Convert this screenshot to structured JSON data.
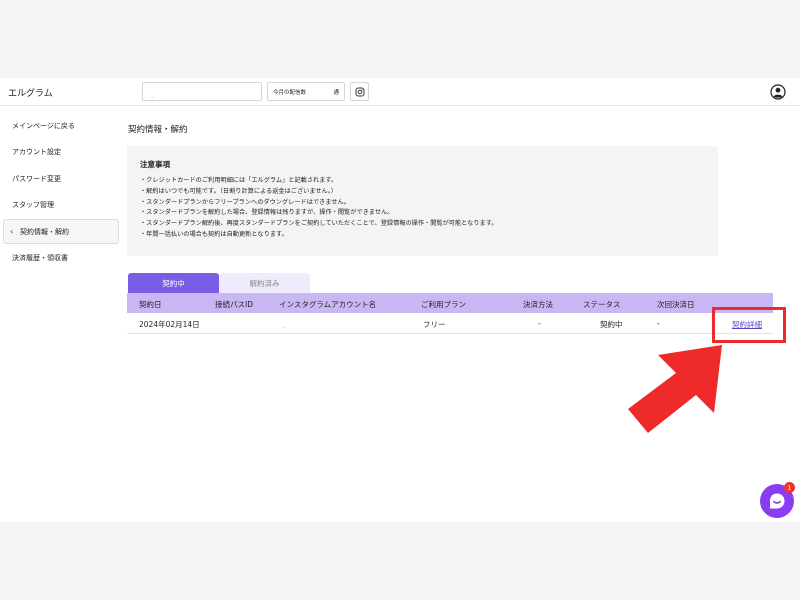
{
  "header": {
    "brand": "エルグラム",
    "search_placeholder": "_",
    "counter_label": "今月の配信数",
    "counter_unit": "通"
  },
  "sidebar": {
    "items": [
      {
        "label": "メインページに戻る"
      },
      {
        "label": "アカウント設定"
      },
      {
        "label": "パスワード変更"
      },
      {
        "label": "スタッフ管理"
      },
      {
        "label": "契約情報・解約",
        "active": true
      },
      {
        "label": "決済履歴・領収書"
      }
    ]
  },
  "main": {
    "title": "契約情報・解約",
    "notice": {
      "title": "注意事項",
      "lines": [
        "・クレジットカードのご利用明細には「エルグラム」と記載されます。",
        "・解約はいつでも可能です。（日割り計算による返金はございません。）",
        "・スタンダードプランからフリープランへのダウングレードはできません。",
        "・スタンダードプランを解約した場合、登録情報は残りますが、操作・閲覧ができません。",
        "・スタンダードプラン解約後、再度スタンダードプランをご契約していただくことで、登録情報の操作・閲覧が可能となります。",
        "・年間一括払いの場合も契約は自動更新となります。"
      ]
    },
    "tabs": [
      {
        "label": "契約中",
        "active": true
      },
      {
        "label": "解約済み",
        "active": false
      }
    ],
    "table": {
      "headers": [
        "契約日",
        "接続パスID",
        "インスタグラムアカウント名",
        "ご利用プラン",
        "決済方法",
        "ステータス",
        "次回決済日"
      ],
      "rows": [
        {
          "date": "2024年02月14日",
          "pass_id": "",
          "account": "_",
          "plan": "フリー",
          "payment": "-",
          "status": "契約中",
          "next_payment": "-",
          "link": "契約詳細"
        }
      ]
    }
  },
  "chat": {
    "badge": "1"
  },
  "colors": {
    "accent": "#7b5ce6",
    "table_header": "#c8b7f3",
    "annotation": "#ee2a2a",
    "chat": "#8b3cf0"
  }
}
